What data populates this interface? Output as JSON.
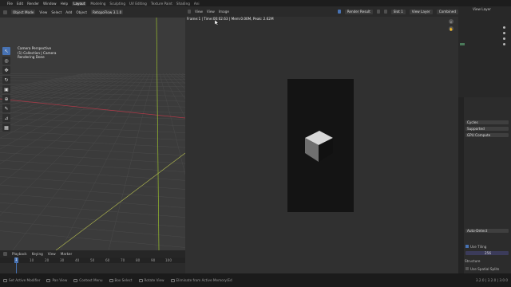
{
  "menu": {
    "items": [
      "File",
      "Edit",
      "Render",
      "Window",
      "Help"
    ],
    "workspaces": [
      "Layout",
      "Modeling",
      "Sculpting",
      "UV Editing",
      "Texture Paint",
      "Shading",
      "Ani"
    ],
    "active_workspace": "Layout"
  },
  "viewport_header": {
    "mode": "Object Mode",
    "menus": [
      "View",
      "Select",
      "Add",
      "Object"
    ],
    "addon_label": "RetopoFlow 3.1.0"
  },
  "viewport_overlay": {
    "line1": "Camera Perspective",
    "line2": "(1) Collection | Camera",
    "line3": "Rendering Done"
  },
  "timeline": {
    "menus": [
      "Playback",
      "Keying",
      "View",
      "Marker"
    ],
    "current_frame": "1",
    "ticks": [
      "10",
      "20",
      "30",
      "40",
      "50",
      "60",
      "70",
      "80",
      "90",
      "100"
    ]
  },
  "status_bar": {
    "items": [
      "Set Active Modifier",
      "Pan View",
      "Context Menu",
      "Box Select",
      "Rotate View",
      "Eliminate from Active Memory/Ed"
    ],
    "version": "3.2.0 | 3.2.0 | 3.0.0"
  },
  "render_window": {
    "menus": [
      "View",
      "View",
      "Image"
    ],
    "image_name": "Render Result",
    "slot": "Slot 1",
    "view_layer": "View Layer",
    "combined": "Combined",
    "info": "Frame:1 | Time:00:02.63 | Mem:0.00M, Peak: 2.62M"
  },
  "right_panel": {
    "outliner_title": "View Layer",
    "render_props": {
      "engine": "Cycles",
      "feature_set": "Supported",
      "device": "GPU Compute",
      "denoise_mode": "Auto-Detect",
      "tiling_label": "Use Tiling",
      "tile_size": "256",
      "section_structure": "Structure",
      "spatial_splits": "Use Spatial Splits"
    }
  },
  "colors": {
    "accent": "#4772b3",
    "logo": "#e87d0d",
    "x_axis": "#b03a48",
    "y_axis": "#9abf2e"
  }
}
